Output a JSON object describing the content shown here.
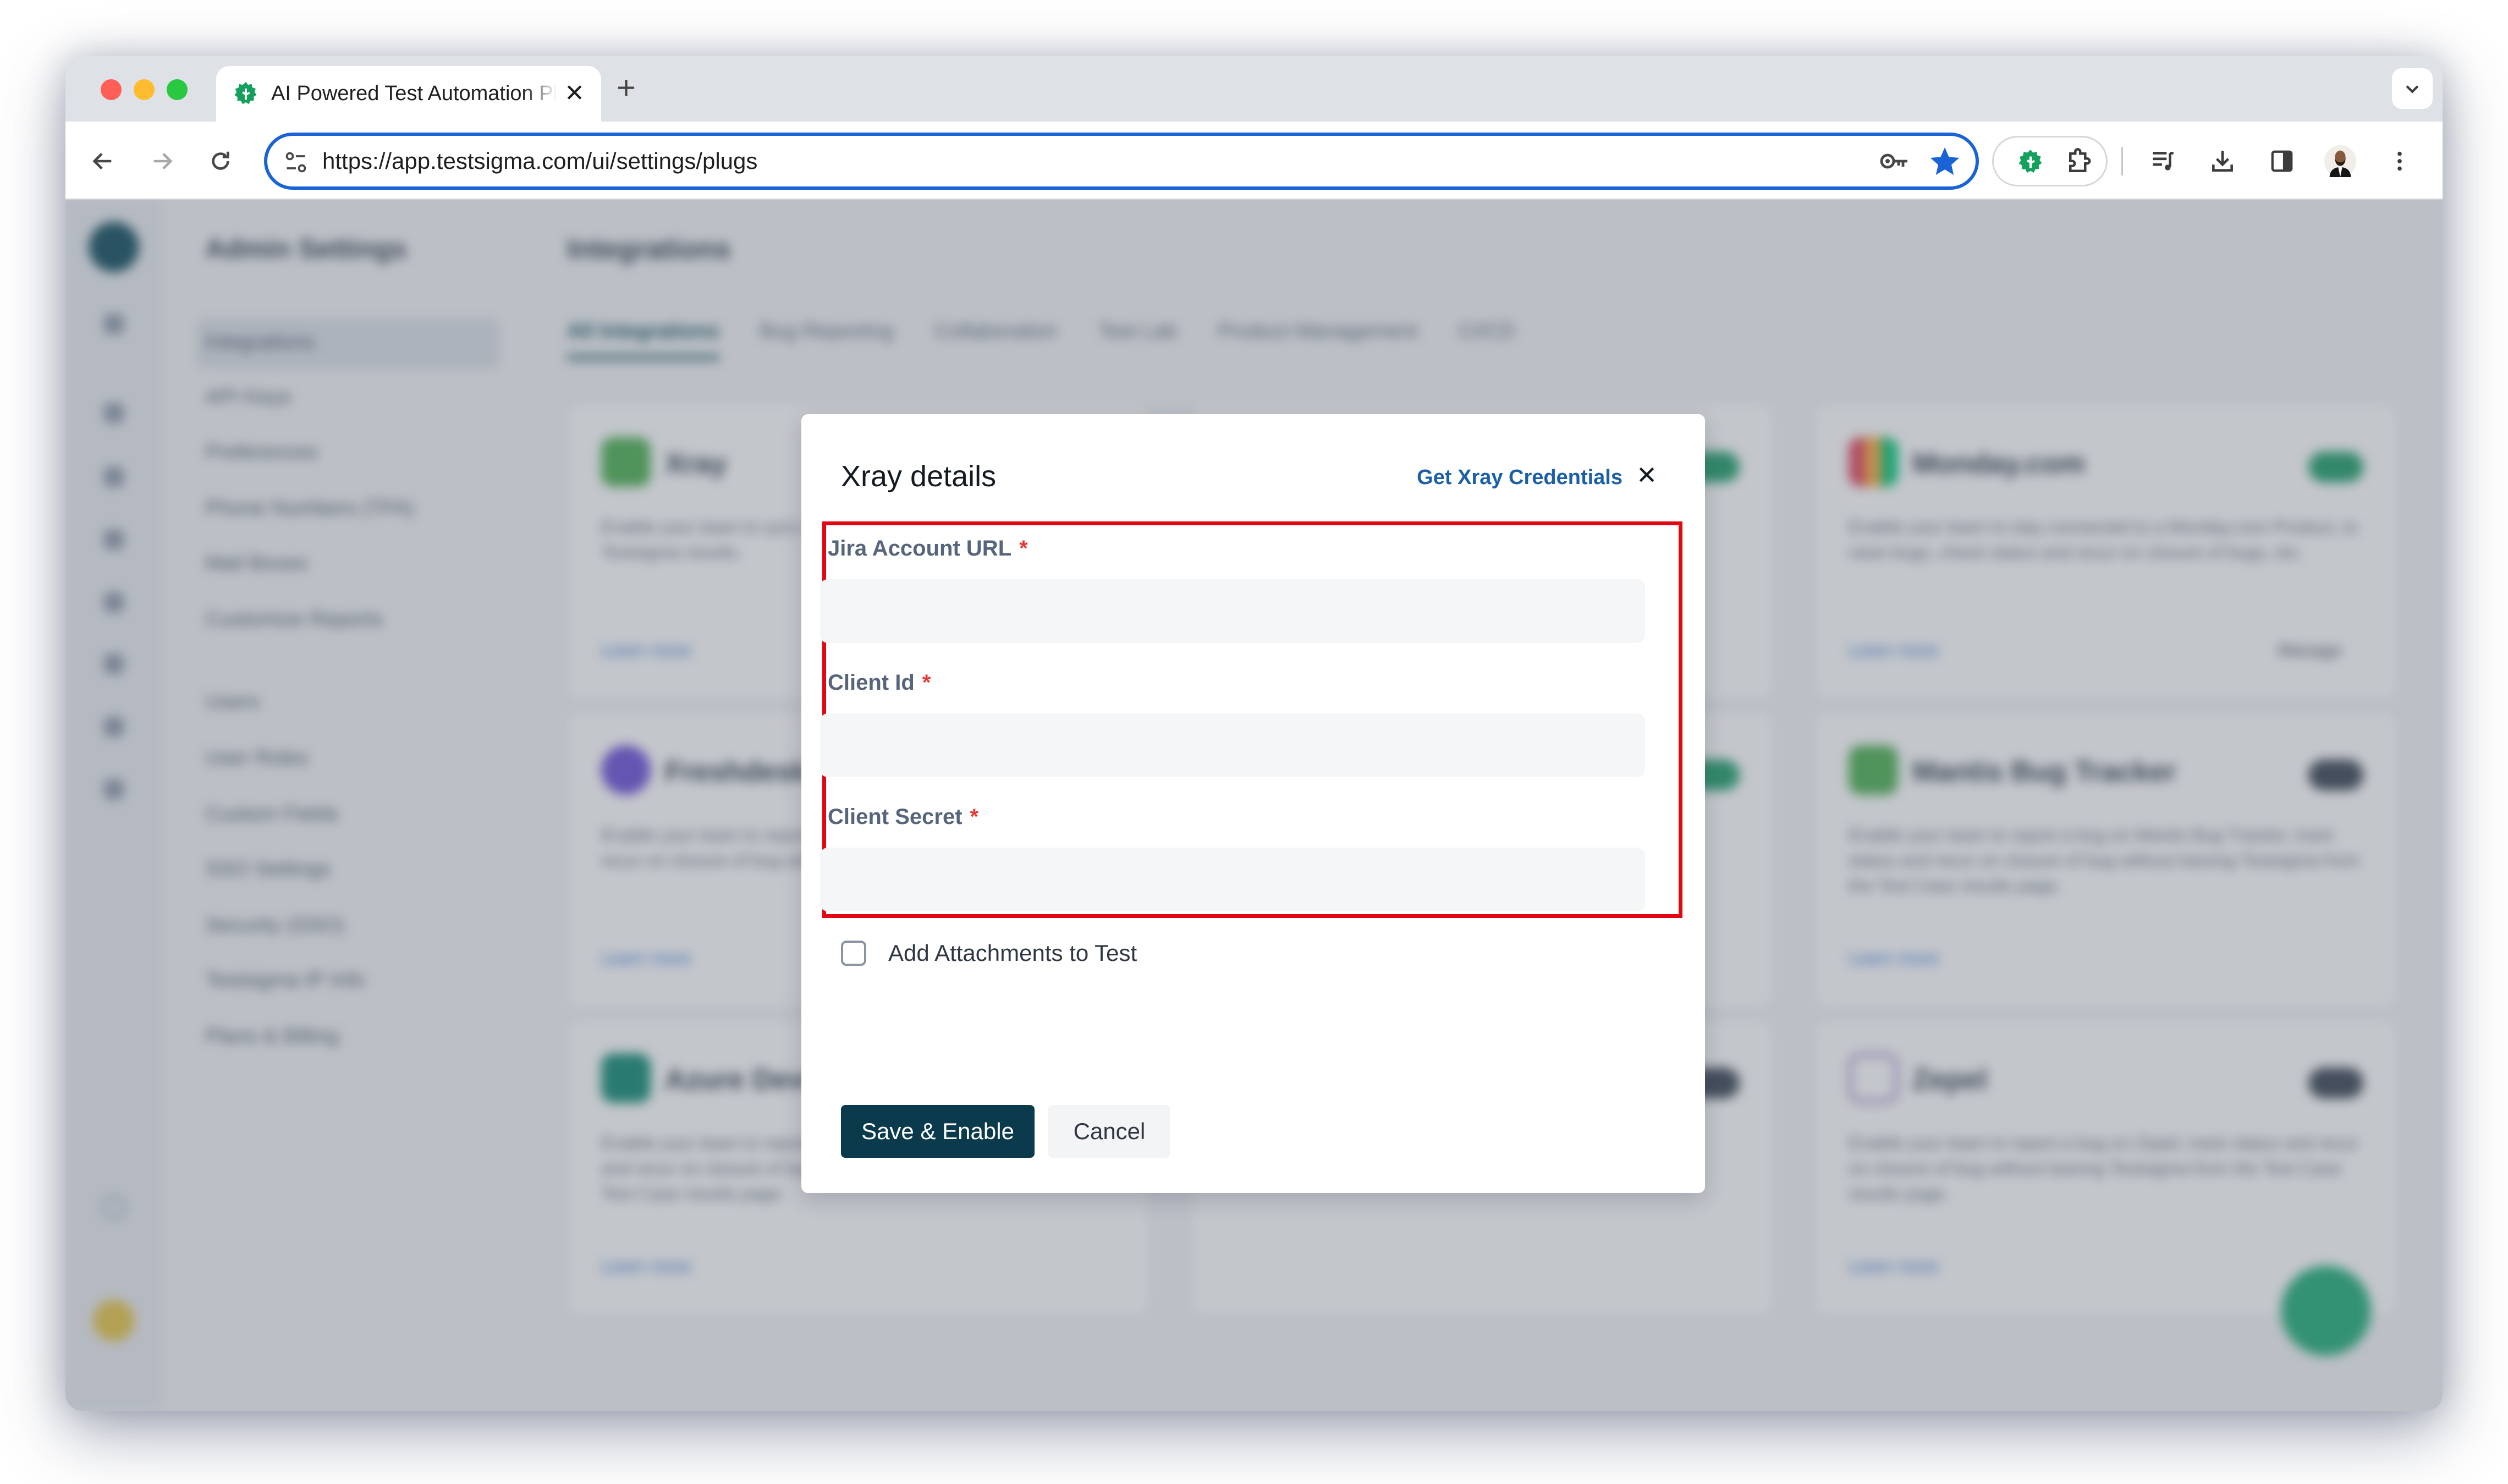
{
  "browser": {
    "tab": {
      "title": "AI Powered Test Automation Platform",
      "favicon": "testsigma-gear-icon"
    },
    "new_tab_label": "+",
    "url": "https://app.testsigma.com/ui/settings/plugs",
    "toolbar_icons": [
      "back-arrow-icon",
      "forward-arrow-icon",
      "reload-icon",
      "site-settings-icon",
      "password-key-icon",
      "bookmark-star-icon",
      "testsigma-extension-icon",
      "extensions-puzzle-icon",
      "media-controls-icon",
      "downloads-icon",
      "side-panel-icon",
      "profile-avatar",
      "more-menu-icon"
    ]
  },
  "app": {
    "sidebar": {
      "title": "Admin Settings",
      "items": [
        {
          "label": "Integrations",
          "active": true
        },
        {
          "label": "API Keys"
        },
        {
          "label": "Preferences"
        },
        {
          "label": "Phone Numbers (TFA)"
        },
        {
          "label": "Mail Boxes"
        },
        {
          "label": "Customize Reports"
        },
        {
          "label": "Users"
        },
        {
          "label": "User Roles"
        },
        {
          "label": "Custom Fields"
        },
        {
          "label": "SSO Settings"
        },
        {
          "label": "Security (SSO)"
        },
        {
          "label": "Testsigma IP Info"
        },
        {
          "label": "Plans & Billing"
        }
      ]
    },
    "page_title": "Integrations",
    "tabs": [
      {
        "label": "All Integrations",
        "active": true
      },
      {
        "label": "Bug Reporting"
      },
      {
        "label": "Collaboration"
      },
      {
        "label": "Test Lab"
      },
      {
        "label": "Product Management"
      },
      {
        "label": "CI/CD"
      }
    ],
    "cards": [
      {
        "name": "Xray",
        "desc": "Enable your team to sync test cases with Xray and push Testsigma results.",
        "link": "Learn more",
        "enabled": false,
        "logo_color": "#4caf50"
      },
      {
        "name": "Monday.com",
        "desc": "Enable your team to stay connected to a Monday.com Product, to raise bugs, check status and recur on closure of bugs, etc.",
        "link": "Learn more",
        "manage": "Manage",
        "enabled": true,
        "logo_color": "#e2445c"
      },
      {
        "name": "Freshdesk",
        "desc": "Enable your team to report a bug on Freshdesk, track status and recur on closure of bug without leaving Testsigma.",
        "link": "Learn more",
        "enabled": false,
        "logo_color": "#6b4fd8"
      },
      {
        "name": "Mantis Bug Tracker",
        "desc": "Enable your team to report a bug on Mantis Bug Tracker, track status and recur on closure of bug without leaving Testsigma from the Test Case results page.",
        "link": "Learn more",
        "enabled": false,
        "logo_color": "#4caf50"
      },
      {
        "name": "Azure DevOps",
        "desc": "Enable your team to report a bug on Azure Boards, track status and recur on closure of bug without leaving Testsigma from the Test Case results page.",
        "link": "Learn more",
        "enabled": false,
        "logo_color": "#0f8a72"
      },
      {
        "name": "Zepel",
        "desc": "Enable your team to report a bug on Zepel, track status and recur on closure of bug without leaving Testsigma from the Test Case results page.",
        "link": "Learn more",
        "enabled": false,
        "logo_color": "#8e7cc3"
      }
    ]
  },
  "modal": {
    "title": "Xray details",
    "credentials_link": "Get Xray Credentials",
    "close_icon": "close-x-icon",
    "fields": [
      {
        "label": "Jira Account URL",
        "required_mark": "*",
        "value": "",
        "placeholder": ""
      },
      {
        "label": "Client Id",
        "required_mark": "*",
        "value": "",
        "placeholder": ""
      },
      {
        "label": "Client Secret",
        "required_mark": "*",
        "value": "",
        "placeholder": ""
      }
    ],
    "checkbox": {
      "label": "Add Attachments to Test",
      "checked": false
    },
    "primary_button": "Save & Enable",
    "secondary_button": "Cancel",
    "highlight_color": "#e30613"
  }
}
